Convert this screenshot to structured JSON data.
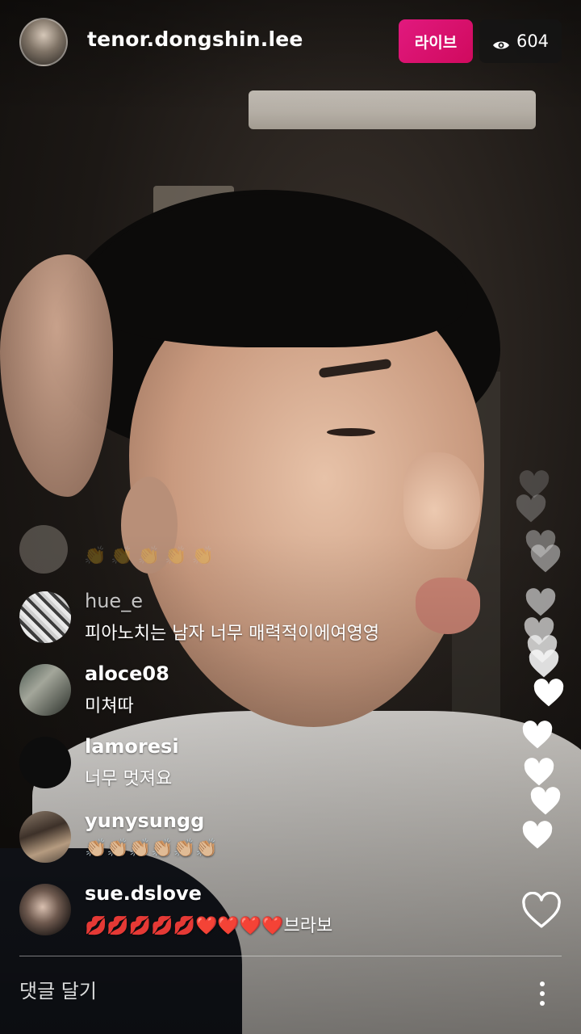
{
  "header": {
    "host_username": "tenor.dongshin.lee",
    "live_label": "라이브",
    "viewer_count": "604",
    "live_color": "#E1197E"
  },
  "comments": [
    {
      "username": "hue_e",
      "text": "피아노치는 남자 너무 매력적이에여영영"
    },
    {
      "username": "aloce08",
      "text": "미쳐따"
    },
    {
      "username": "lamoresi",
      "text": "너무 멋져요"
    },
    {
      "username": "yunysungg",
      "text": "👏🏼👏🏼👏🏼👏🏼👏🏼👏🏼"
    },
    {
      "username": "sue.dslove",
      "text": "💋💋💋💋💋❤️❤️❤️❤️브라보"
    }
  ],
  "faded_comment_emoji": "👏👏👏👏👏",
  "footer": {
    "comment_placeholder": "댓글 달기"
  },
  "icons": {
    "viewers": "eye-icon",
    "like": "heart-outline-icon",
    "more": "more-vertical-icon",
    "floating": "heart-icon"
  }
}
